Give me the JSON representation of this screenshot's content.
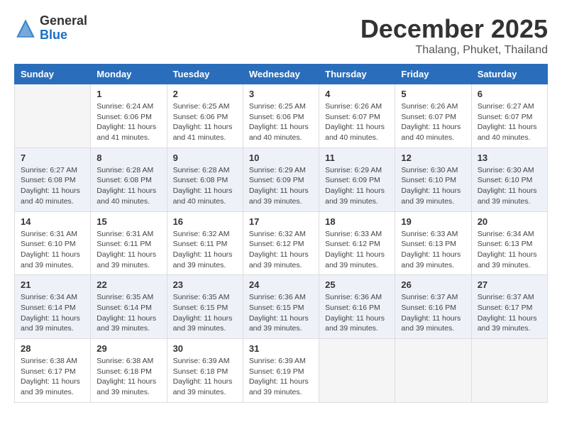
{
  "header": {
    "logo_general": "General",
    "logo_blue": "Blue",
    "month_year": "December 2025",
    "location": "Thalang, Phuket, Thailand"
  },
  "days_of_week": [
    "Sunday",
    "Monday",
    "Tuesday",
    "Wednesday",
    "Thursday",
    "Friday",
    "Saturday"
  ],
  "weeks": [
    [
      {
        "day": "",
        "info": ""
      },
      {
        "day": "1",
        "info": "Sunrise: 6:24 AM\nSunset: 6:06 PM\nDaylight: 11 hours\nand 41 minutes."
      },
      {
        "day": "2",
        "info": "Sunrise: 6:25 AM\nSunset: 6:06 PM\nDaylight: 11 hours\nand 41 minutes."
      },
      {
        "day": "3",
        "info": "Sunrise: 6:25 AM\nSunset: 6:06 PM\nDaylight: 11 hours\nand 40 minutes."
      },
      {
        "day": "4",
        "info": "Sunrise: 6:26 AM\nSunset: 6:07 PM\nDaylight: 11 hours\nand 40 minutes."
      },
      {
        "day": "5",
        "info": "Sunrise: 6:26 AM\nSunset: 6:07 PM\nDaylight: 11 hours\nand 40 minutes."
      },
      {
        "day": "6",
        "info": "Sunrise: 6:27 AM\nSunset: 6:07 PM\nDaylight: 11 hours\nand 40 minutes."
      }
    ],
    [
      {
        "day": "7",
        "info": "Sunrise: 6:27 AM\nSunset: 6:08 PM\nDaylight: 11 hours\nand 40 minutes."
      },
      {
        "day": "8",
        "info": "Sunrise: 6:28 AM\nSunset: 6:08 PM\nDaylight: 11 hours\nand 40 minutes."
      },
      {
        "day": "9",
        "info": "Sunrise: 6:28 AM\nSunset: 6:08 PM\nDaylight: 11 hours\nand 40 minutes."
      },
      {
        "day": "10",
        "info": "Sunrise: 6:29 AM\nSunset: 6:09 PM\nDaylight: 11 hours\nand 39 minutes."
      },
      {
        "day": "11",
        "info": "Sunrise: 6:29 AM\nSunset: 6:09 PM\nDaylight: 11 hours\nand 39 minutes."
      },
      {
        "day": "12",
        "info": "Sunrise: 6:30 AM\nSunset: 6:10 PM\nDaylight: 11 hours\nand 39 minutes."
      },
      {
        "day": "13",
        "info": "Sunrise: 6:30 AM\nSunset: 6:10 PM\nDaylight: 11 hours\nand 39 minutes."
      }
    ],
    [
      {
        "day": "14",
        "info": "Sunrise: 6:31 AM\nSunset: 6:10 PM\nDaylight: 11 hours\nand 39 minutes."
      },
      {
        "day": "15",
        "info": "Sunrise: 6:31 AM\nSunset: 6:11 PM\nDaylight: 11 hours\nand 39 minutes."
      },
      {
        "day": "16",
        "info": "Sunrise: 6:32 AM\nSunset: 6:11 PM\nDaylight: 11 hours\nand 39 minutes."
      },
      {
        "day": "17",
        "info": "Sunrise: 6:32 AM\nSunset: 6:12 PM\nDaylight: 11 hours\nand 39 minutes."
      },
      {
        "day": "18",
        "info": "Sunrise: 6:33 AM\nSunset: 6:12 PM\nDaylight: 11 hours\nand 39 minutes."
      },
      {
        "day": "19",
        "info": "Sunrise: 6:33 AM\nSunset: 6:13 PM\nDaylight: 11 hours\nand 39 minutes."
      },
      {
        "day": "20",
        "info": "Sunrise: 6:34 AM\nSunset: 6:13 PM\nDaylight: 11 hours\nand 39 minutes."
      }
    ],
    [
      {
        "day": "21",
        "info": "Sunrise: 6:34 AM\nSunset: 6:14 PM\nDaylight: 11 hours\nand 39 minutes."
      },
      {
        "day": "22",
        "info": "Sunrise: 6:35 AM\nSunset: 6:14 PM\nDaylight: 11 hours\nand 39 minutes."
      },
      {
        "day": "23",
        "info": "Sunrise: 6:35 AM\nSunset: 6:15 PM\nDaylight: 11 hours\nand 39 minutes."
      },
      {
        "day": "24",
        "info": "Sunrise: 6:36 AM\nSunset: 6:15 PM\nDaylight: 11 hours\nand 39 minutes."
      },
      {
        "day": "25",
        "info": "Sunrise: 6:36 AM\nSunset: 6:16 PM\nDaylight: 11 hours\nand 39 minutes."
      },
      {
        "day": "26",
        "info": "Sunrise: 6:37 AM\nSunset: 6:16 PM\nDaylight: 11 hours\nand 39 minutes."
      },
      {
        "day": "27",
        "info": "Sunrise: 6:37 AM\nSunset: 6:17 PM\nDaylight: 11 hours\nand 39 minutes."
      }
    ],
    [
      {
        "day": "28",
        "info": "Sunrise: 6:38 AM\nSunset: 6:17 PM\nDaylight: 11 hours\nand 39 minutes."
      },
      {
        "day": "29",
        "info": "Sunrise: 6:38 AM\nSunset: 6:18 PM\nDaylight: 11 hours\nand 39 minutes."
      },
      {
        "day": "30",
        "info": "Sunrise: 6:39 AM\nSunset: 6:18 PM\nDaylight: 11 hours\nand 39 minutes."
      },
      {
        "day": "31",
        "info": "Sunrise: 6:39 AM\nSunset: 6:19 PM\nDaylight: 11 hours\nand 39 minutes."
      },
      {
        "day": "",
        "info": ""
      },
      {
        "day": "",
        "info": ""
      },
      {
        "day": "",
        "info": ""
      }
    ]
  ]
}
